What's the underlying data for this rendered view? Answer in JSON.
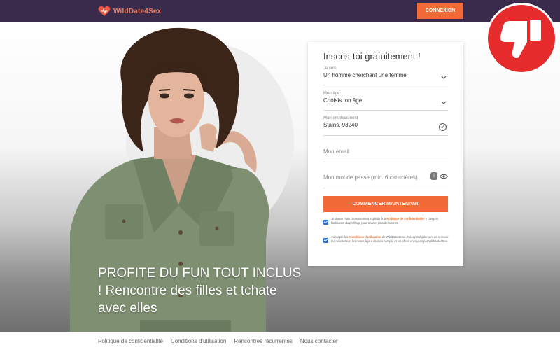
{
  "header": {
    "logo_text": "WildDate4Sex",
    "login_label": "CONNEXION",
    "accent_color": "#f26a38",
    "bar_color": "#3a2a4b"
  },
  "hero": {
    "headline": "PROFITE DU FUN TOUT INCLUS ! Rencontre des filles et tchate avec elles"
  },
  "form": {
    "title": "Inscris-toi gratuitement !",
    "iam": {
      "label": "Je suis",
      "value": "Un homme cherchant une femme"
    },
    "age": {
      "label": "Mon âge",
      "value": "Choisis ton âge"
    },
    "location": {
      "label": "Mon emplacement",
      "value": "Stains, 93240"
    },
    "email": {
      "placeholder": "Mon email"
    },
    "password": {
      "placeholder": "Mon mot de passe (min. 6 caractères)"
    },
    "submit_label": "COMMENCER MAINTENANT",
    "consent1": {
      "before": "Je donne mon consentement explicite à la ",
      "link": "Politique de confidentialité",
      "after": ", y compris l'utilisation du profilage pour trouver plus de matchs."
    },
    "consent2": {
      "before": "J'accepte les ",
      "link": "Conditions d'utilisation",
      "after": " de WildDate4Sex. J'accepte également de recevoir les newsletters, les mises à jour de mon compte et les offres envoyées par WildDate4Sex."
    }
  },
  "footer": {
    "links": [
      "Politique de confidentialité",
      "Conditions d'utilisation",
      "Rencontres récurrentes",
      "Nous contacter"
    ]
  },
  "badge": {
    "icon": "thumbs-down-icon",
    "color": "#e52b2b"
  }
}
